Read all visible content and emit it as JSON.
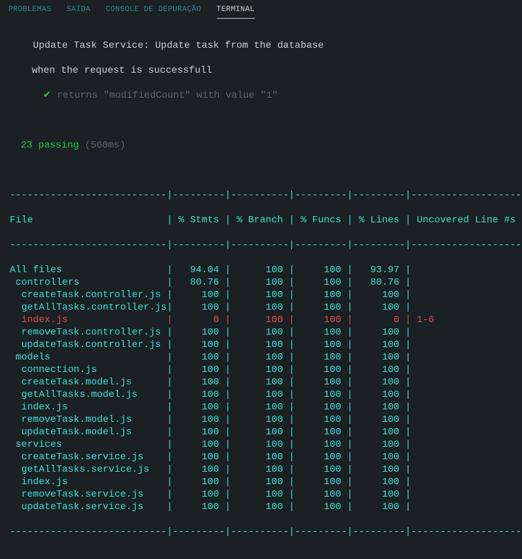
{
  "tabs": {
    "problems": "PROBLEMAS",
    "output": "SAÍDA",
    "debug": "CONSOLE DE DEPURAÇÃO",
    "terminal": "TERMINAL"
  },
  "test": {
    "suite_line": "    Update Task Service: Update task from the database",
    "context_line": "when the request is successfull",
    "check": "✔",
    "test_name": "returns \"modifiedCount\" with value \"1\"",
    "passing_count": "23 passing",
    "passing_time": "(560ms)"
  },
  "coverage": {
    "rule": "---------------------------|---------|----------|---------|---------|-------------------",
    "header": "File                       | % Stmts | % Branch | % Funcs | % Lines | Uncovered Line #s ",
    "rows": [
      {
        "text": "All files                  |   94.04 |      100 |     100 |   93.97 |                   ",
        "red": false
      },
      {
        "text": " controllers               |   80.76 |      100 |     100 |   80.76 |                   ",
        "red": false
      },
      {
        "text": "  createTask.controller.js |     100 |      100 |     100 |     100 |                   ",
        "red": false
      },
      {
        "text": "  getAllTasks.controller.js|     100 |      100 |     100 |     100 |                   ",
        "red": false
      },
      {
        "text": "  index.js                 |       0 |      100 |     100 |       0 | 1-6               ",
        "red": true
      },
      {
        "text": "  removeTask.controller.js |     100 |      100 |     100 |     100 |                   ",
        "red": false
      },
      {
        "text": "  updateTask.controller.js |     100 |      100 |     100 |     100 |                   ",
        "red": false
      },
      {
        "text": " models                    |     100 |      100 |     100 |     100 |                   ",
        "red": false
      },
      {
        "text": "  connection.js            |     100 |      100 |     100 |     100 |                   ",
        "red": false
      },
      {
        "text": "  createTask.model.js      |     100 |      100 |     100 |     100 |                   ",
        "red": false
      },
      {
        "text": "  getAllTasks.model.js     |     100 |      100 |     100 |     100 |                   ",
        "red": false
      },
      {
        "text": "  index.js                 |     100 |      100 |     100 |     100 |                   ",
        "red": false
      },
      {
        "text": "  removeTask.model.js      |     100 |      100 |     100 |     100 |                   ",
        "red": false
      },
      {
        "text": "  updateTask.model.js      |     100 |      100 |     100 |     100 |                   ",
        "red": false
      },
      {
        "text": " services                  |     100 |      100 |     100 |     100 |                   ",
        "red": false
      },
      {
        "text": "  createTask.service.js    |     100 |      100 |     100 |     100 |                   ",
        "red": false
      },
      {
        "text": "  getAllTasks.service.js   |     100 |      100 |     100 |     100 |                   ",
        "red": false
      },
      {
        "text": "  index.js                 |     100 |      100 |     100 |     100 |                   ",
        "red": false
      },
      {
        "text": "  removeTask.service.js    |     100 |      100 |     100 |     100 |                   ",
        "red": false
      },
      {
        "text": "  updateTask.service.js    |     100 |      100 |     100 |     100 |                   ",
        "red": false
      }
    ]
  }
}
